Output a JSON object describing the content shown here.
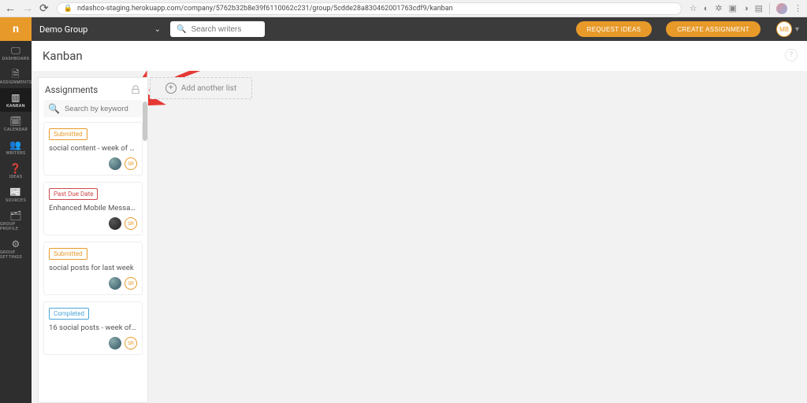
{
  "browser": {
    "url": "ndashco-staging.herokuapp.com/company/5762b32b8e39f6110062c231/group/5cdde28a830462001763cdf9/kanban"
  },
  "topbar": {
    "group_name": "Demo Group",
    "search_placeholder": "Search writers",
    "request_ideas": "REQUEST IDEAS",
    "create_assignment": "CREATE ASSIGNMENT",
    "user_initials": "MB"
  },
  "nav": {
    "items": [
      {
        "id": "dashboard",
        "label": "DASHBOARD",
        "icon": "🖵"
      },
      {
        "id": "assignments",
        "label": "ASSIGNMENTS",
        "icon": "🗎"
      },
      {
        "id": "kanban",
        "label": "KANBAN",
        "icon": "▥"
      },
      {
        "id": "calendar",
        "label": "CALENDAR",
        "icon": "🗓"
      },
      {
        "id": "writers",
        "label": "WRITERS",
        "icon": "👥"
      },
      {
        "id": "ideas",
        "label": "IDEAS",
        "icon": "❓"
      },
      {
        "id": "sources",
        "label": "SOURCES",
        "icon": "📰"
      },
      {
        "id": "group-profile",
        "label": "GROUP PROFILE",
        "icon": "🗂"
      },
      {
        "id": "group-settings",
        "label": "GROUP SETTINGS",
        "icon": "⚙"
      }
    ],
    "active": "kanban"
  },
  "page": {
    "title": "Kanban"
  },
  "board": {
    "column_title": "Assignments",
    "search_placeholder": "Search by keyword",
    "add_list": "Add another list",
    "cards": [
      {
        "status": "Submitted",
        "status_class": "submitted",
        "title": "social content - week of …",
        "avatars": [
          "img",
          "out"
        ],
        "out_text": "SR"
      },
      {
        "status": "Past Due Date",
        "status_class": "past",
        "title": "Enhanced Mobile Messa…",
        "avatars": [
          "img2",
          "out"
        ],
        "out_text": "SR"
      },
      {
        "status": "Submitted",
        "status_class": "submitted",
        "title": "social posts for last week",
        "avatars": [
          "img",
          "out"
        ],
        "out_text": "SR"
      },
      {
        "status": "Completed",
        "status_class": "completed",
        "title": "16 social posts - week of …",
        "avatars": [
          "img",
          "out"
        ],
        "out_text": "SR"
      }
    ]
  }
}
